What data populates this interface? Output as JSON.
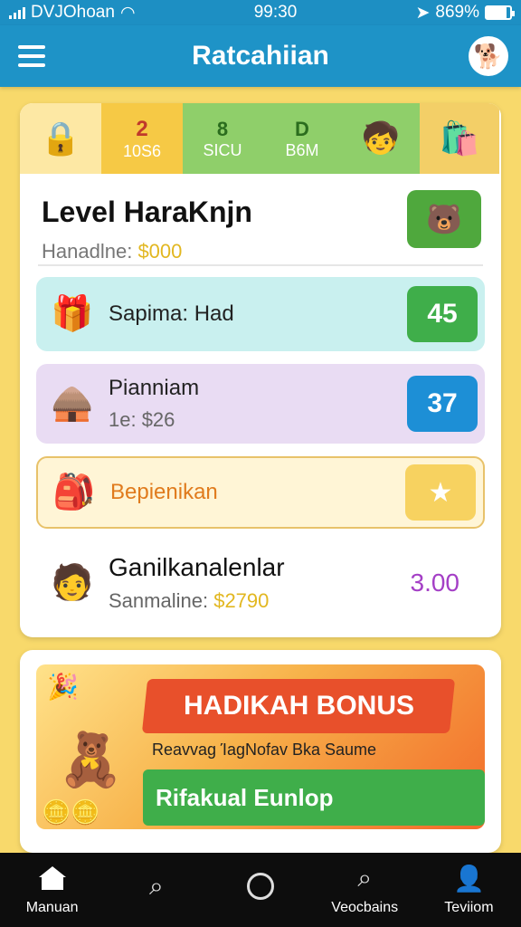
{
  "status_bar": {
    "carrier": "DVJOhoan",
    "time": "99:30",
    "battery": "869%"
  },
  "header": {
    "title": "Ratcahiian",
    "menu_icon": "hamburger-menu-icon",
    "avatar_icon": "mascot-avatar-icon"
  },
  "top_strip": [
    {
      "icon": "padlock-icon"
    },
    {
      "number": "2",
      "label": "10S6"
    },
    {
      "number": "8",
      "label": "SICU"
    },
    {
      "number": "D",
      "label": "B6M"
    },
    {
      "icon": "character-icon"
    },
    {
      "icon": "shopping-bag-icon"
    }
  ],
  "level": {
    "title": "Level HaraKnjn",
    "subtitle_label": "Hanadlne:",
    "subtitle_amount": "$000",
    "badge_icon": "mascot-bear-icon"
  },
  "rows": [
    {
      "title": "Sapima: Had",
      "value": "45",
      "icon": "gift-box-icon",
      "color": "#3fae4a"
    },
    {
      "title": "Pianniam",
      "sub": "1e: $26",
      "value": "37",
      "icon": "hut-icon",
      "color": "#1d8fd6"
    },
    {
      "title": "Bepienikan",
      "icon": "backpack-icon",
      "badge_icon": "star-icon"
    },
    {
      "title": "Ganilkanalenlar",
      "sub_label": "Sanmaline:",
      "sub_amount": "$2790",
      "value": "3.00",
      "icon": "character-icon"
    }
  ],
  "bonus": {
    "title": "HADIKAH BONUS",
    "description": "Reavvag ΊagNofav Bka Saume",
    "cta": "Rifakual Eunlop"
  },
  "bottom_nav": [
    {
      "label": "Manuan",
      "icon": "home-icon"
    },
    {
      "label": "",
      "icon": "search-icon"
    },
    {
      "label": "",
      "icon": "circle-icon"
    },
    {
      "label": "Veocbains",
      "icon": "search-icon"
    },
    {
      "label": "Teviiom",
      "icon": "profile-icon"
    }
  ]
}
